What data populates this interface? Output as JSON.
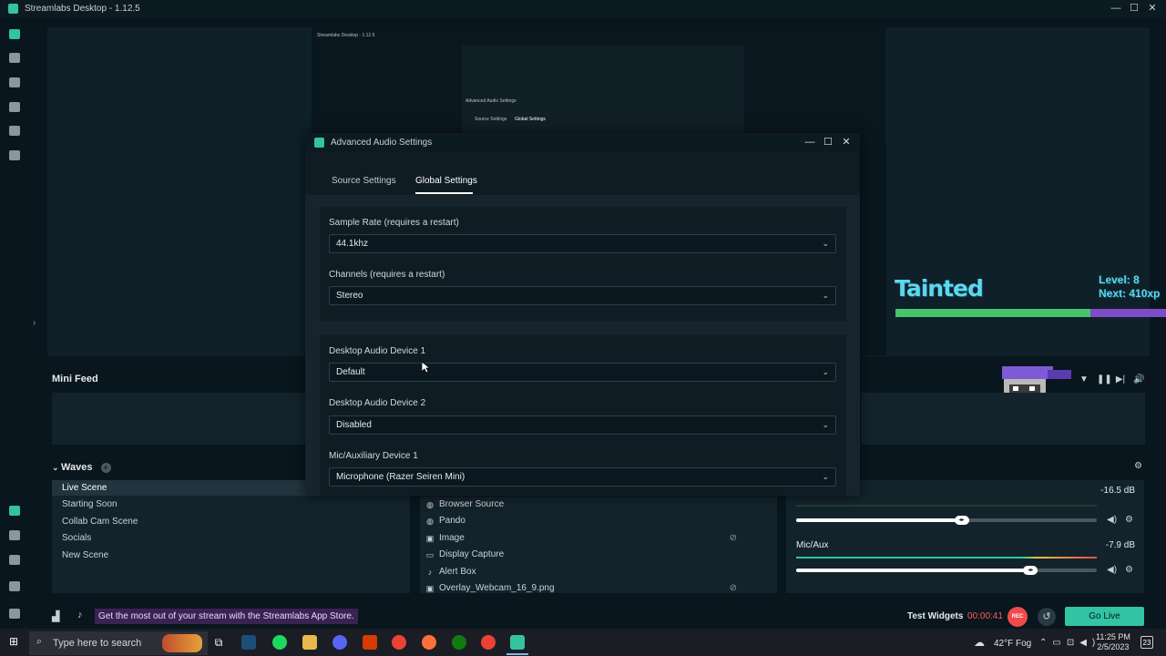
{
  "app": {
    "title": "Streamlabs Desktop - 1.12.5"
  },
  "window_controls": {
    "minimize": "—",
    "maximize": "☐",
    "close": "✕"
  },
  "preview": {
    "overlay_name": "Tainted",
    "level_line1": "Level: 8",
    "level_line2": "Next: 410xp",
    "xp_progress": 0.72,
    "nested_dialog_title": "Advanced Audio Settings",
    "nested_tab1": "Source Settings",
    "nested_tab2": "Global Settings"
  },
  "mini_feed": {
    "title": "Mini Feed"
  },
  "scenes": {
    "collection": "Waves",
    "items": [
      {
        "label": "Live Scene",
        "active": true
      },
      {
        "label": "Starting Soon",
        "active": false
      },
      {
        "label": "Collab Cam Scene",
        "active": false
      },
      {
        "label": "Socials",
        "active": false
      },
      {
        "label": "New Scene",
        "active": false
      }
    ]
  },
  "sources": {
    "items": [
      {
        "label": "Browser Source",
        "icon": "globe-icon"
      },
      {
        "label": "Pando",
        "icon": "globe-icon"
      },
      {
        "label": "Image",
        "icon": "image-icon",
        "hidden": true
      },
      {
        "label": "Display Capture",
        "icon": "monitor-icon"
      },
      {
        "label": "Alert Box",
        "icon": "bell-icon"
      },
      {
        "label": "Overlay_Webcam_16_9.png",
        "icon": "image-icon",
        "hidden": true
      }
    ]
  },
  "mixer": {
    "channel1": {
      "label": "",
      "db": "-16.5 dB",
      "level": 0.55
    },
    "channel2": {
      "label": "Mic/Aux",
      "db": "-7.9 dB",
      "level": 0.78
    }
  },
  "bottom": {
    "promo": "Get the most out of your stream with the Streamlabs App Store.",
    "test_widgets": "Test Widgets",
    "timer": "00:00:41",
    "rec": "REC",
    "go_live": "Go Live"
  },
  "modal": {
    "title": "Advanced Audio Settings",
    "tabs": [
      {
        "label": "Source Settings",
        "active": false
      },
      {
        "label": "Global Settings",
        "active": true
      }
    ],
    "sample_rate_label": "Sample Rate (requires a restart)",
    "sample_rate_value": "44.1khz",
    "channels_label": "Channels (requires a restart)",
    "channels_value": "Stereo",
    "desktop1_label": "Desktop Audio Device 1",
    "desktop1_value": "Default",
    "desktop2_label": "Desktop Audio Device 2",
    "desktop2_value": "Disabled",
    "mic1_label": "Mic/Auxiliary Device 1",
    "mic1_value": "Microphone (Razer Seiren Mini)"
  },
  "taskbar": {
    "search_placeholder": "Type here to search",
    "weather": "42°F  Fog",
    "time": "11:25 PM",
    "date": "2/5/2023",
    "notifications": "23"
  },
  "colors": {
    "accent": "#31c3a2",
    "rec": "#ef4b4b",
    "promo_bg": "#3a2354",
    "xp_fill": "#46c46a",
    "xp_bg": "#7d4cc9"
  }
}
